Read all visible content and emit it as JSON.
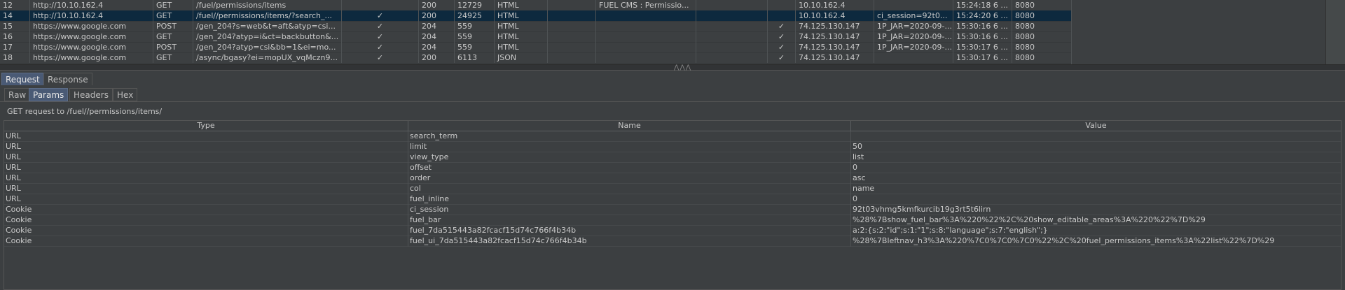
{
  "history": {
    "rows": [
      {
        "num": "12",
        "host": "http://10.10.162.4",
        "method": "GET",
        "url": "/fuel/permissions/items",
        "params": "",
        "status": "200",
        "length": "12729",
        "mime": "HTML",
        "title": "FUEL CMS : Permissio...",
        "ssl": "",
        "ip": "10.10.162.4",
        "cookies": "",
        "time": "15:24:18 6 ...",
        "port": "8080"
      },
      {
        "num": "14",
        "host": "http://10.10.162.4",
        "method": "GET",
        "url": "/fuel//permissions/items/?search_...",
        "params": "✓",
        "status": "200",
        "length": "24925",
        "mime": "HTML",
        "title": "",
        "ssl": "",
        "ip": "10.10.162.4",
        "cookies": "ci_session=92t0...",
        "time": "15:24:20 6 ...",
        "port": "8080"
      },
      {
        "num": "15",
        "host": "https://www.google.com",
        "method": "POST",
        "url": "/gen_204?s=web&t=aft&atyp=csi...",
        "params": "✓",
        "status": "204",
        "length": "559",
        "mime": "HTML",
        "title": "",
        "ssl": "✓",
        "ip": "74.125.130.147",
        "cookies": "1P_JAR=2020-09-...",
        "time": "15:30:16 6 ...",
        "port": "8080"
      },
      {
        "num": "16",
        "host": "https://www.google.com",
        "method": "GET",
        "url": "/gen_204?atyp=i&ct=backbutton&...",
        "params": "✓",
        "status": "204",
        "length": "559",
        "mime": "HTML",
        "title": "",
        "ssl": "✓",
        "ip": "74.125.130.147",
        "cookies": "1P_JAR=2020-09-...",
        "time": "15:30:16 6 ...",
        "port": "8080"
      },
      {
        "num": "17",
        "host": "https://www.google.com",
        "method": "POST",
        "url": "/gen_204?atyp=csi&bb=1&ei=mo...",
        "params": "✓",
        "status": "204",
        "length": "559",
        "mime": "HTML",
        "title": "",
        "ssl": "✓",
        "ip": "74.125.130.147",
        "cookies": "1P_JAR=2020-09-...",
        "time": "15:30:17 6 ...",
        "port": "8080"
      },
      {
        "num": "18",
        "host": "https://www.google.com",
        "method": "GET",
        "url": "/async/bgasy?ei=mopUX_vqMczn9...",
        "params": "✓",
        "status": "200",
        "length": "6113",
        "mime": "JSON",
        "title": "",
        "ssl": "✓",
        "ip": "74.125.130.147",
        "cookies": "",
        "time": "15:30:17 6 ...",
        "port": "8080"
      }
    ],
    "selected_index": 1
  },
  "divider": {
    "grip": "⋀⋀⋀"
  },
  "main_tabs": [
    "Request",
    "Response"
  ],
  "sub_tabs": [
    "Raw",
    "Params",
    "Headers",
    "Hex"
  ],
  "summary": "GET request to /fuel//permissions/items/",
  "params_table": {
    "headers": [
      "Type",
      "Name",
      "Value"
    ],
    "rows": [
      {
        "type": "URL",
        "name": "search_term",
        "value": ""
      },
      {
        "type": "URL",
        "name": "limit",
        "value": "50"
      },
      {
        "type": "URL",
        "name": "view_type",
        "value": "list"
      },
      {
        "type": "URL",
        "name": "offset",
        "value": "0"
      },
      {
        "type": "URL",
        "name": "order",
        "value": "asc"
      },
      {
        "type": "URL",
        "name": "col",
        "value": "name"
      },
      {
        "type": "URL",
        "name": "fuel_inline",
        "value": "0"
      },
      {
        "type": "Cookie",
        "name": "ci_session",
        "value": "92t03vhmg5kmfkurcib19g3rt5t6lirn"
      },
      {
        "type": "Cookie",
        "name": "fuel_bar",
        "value": "%28%7Bshow_fuel_bar%3A%220%22%2C%20show_editable_areas%3A%220%22%7D%29"
      },
      {
        "type": "Cookie",
        "name": "fuel_7da515443a82fcacf15d74c766f4b34b",
        "value": "a:2:{s:2:\"id\";s:1:\"1\";s:8:\"language\";s:7:\"english\";}"
      },
      {
        "type": "Cookie",
        "name": "fuel_ui_7da515443a82fcacf15d74c766f4b34b",
        "value": "%28%7Bleftnav_h3%3A%220%7C0%7C0%7C0%22%2C%20fuel_permissions_items%3A%22list%22%7D%29"
      }
    ]
  }
}
